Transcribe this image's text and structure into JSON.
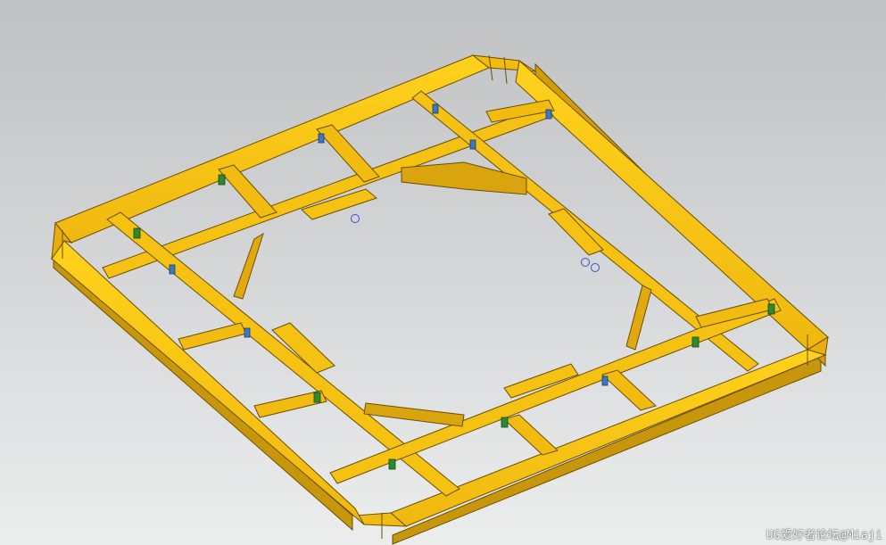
{
  "viewport": {
    "background_top": "#c0c1c3",
    "background_bottom": "#eceded"
  },
  "model": {
    "description_icon": "steel-frame-3d-model",
    "beam_color": "#f5c213",
    "beam_side_color": "#c8960b",
    "beam_edge_color": "#6b4e05",
    "plate_blue": "#3d78c8",
    "plate_green": "#2f8a2f",
    "selection_circle_color": "#3a4fd0"
  },
  "watermark": {
    "text": "UG爱好者论坛@Miaji"
  }
}
